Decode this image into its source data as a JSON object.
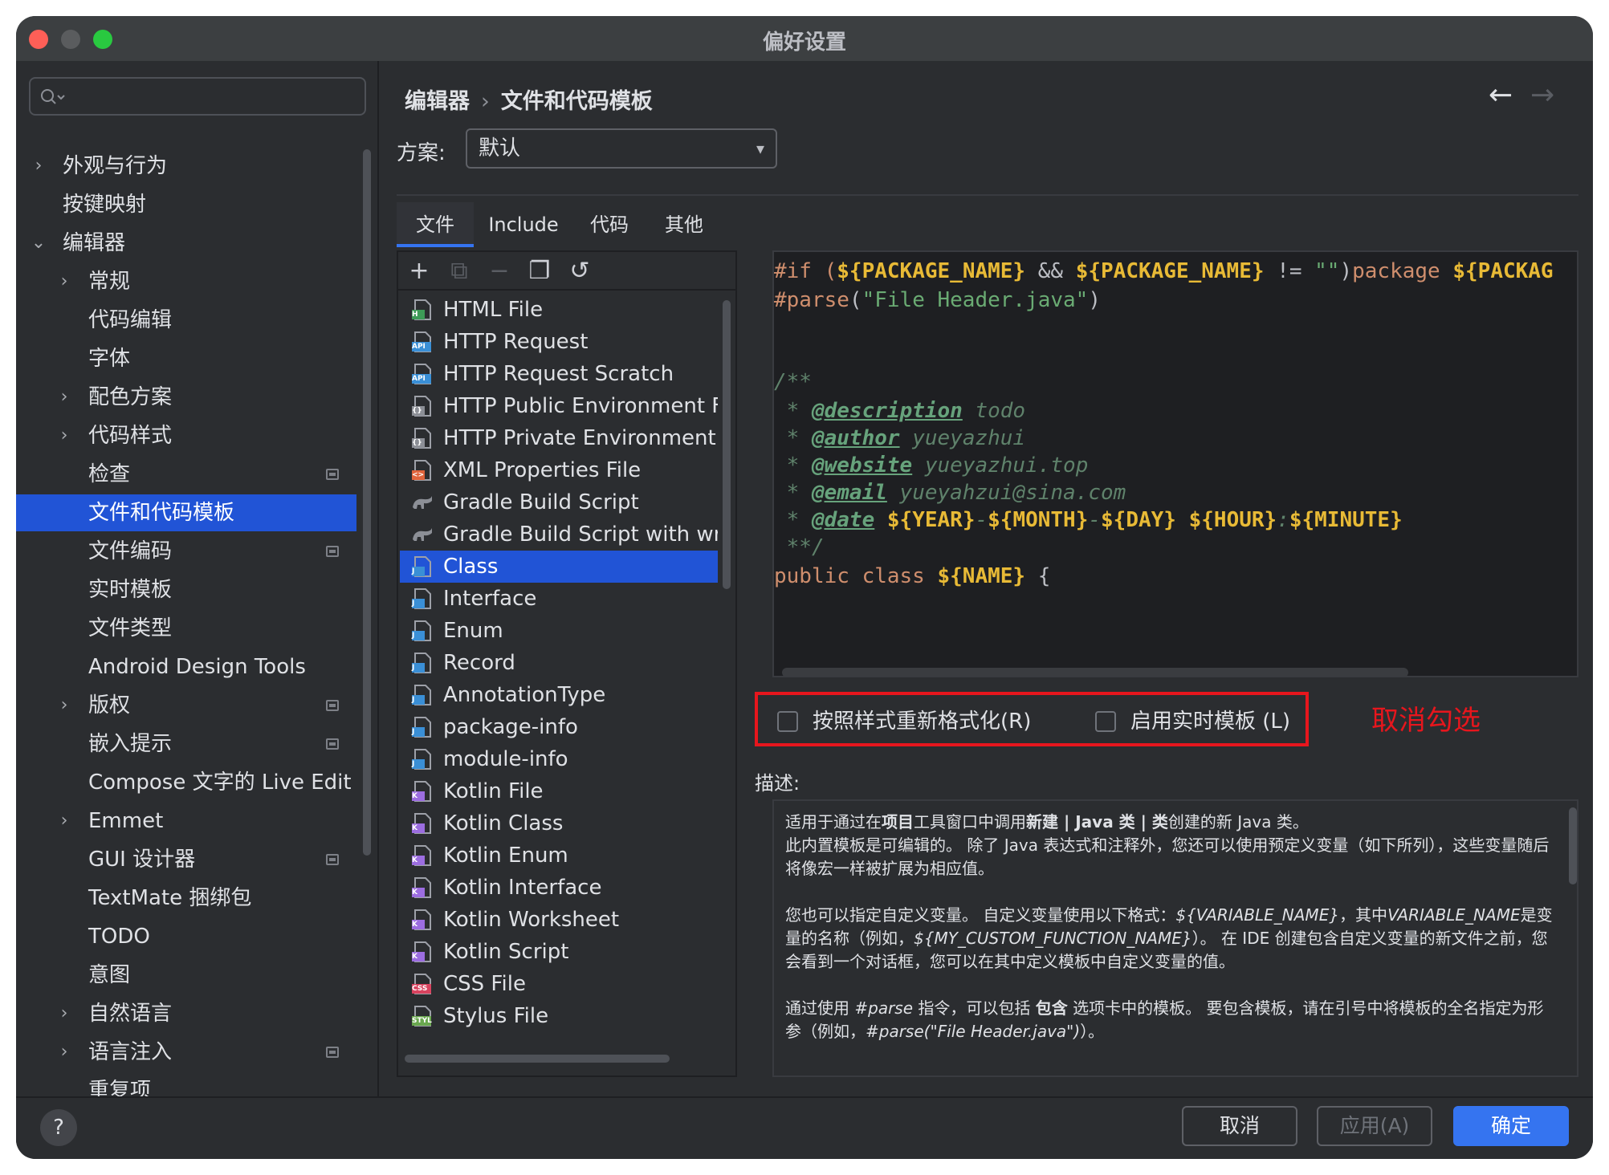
{
  "window": {
    "title": "偏好设置"
  },
  "search": {
    "placeholder": ""
  },
  "sidebar": {
    "items": [
      {
        "label": "外观与行为",
        "chevron": "›",
        "badge": false,
        "selected": false
      },
      {
        "label": "按键映射",
        "chevron": "",
        "badge": false,
        "selected": false
      },
      {
        "label": "编辑器",
        "chevron": "⌄",
        "badge": false,
        "selected": false
      },
      {
        "label": "常规",
        "chevron": "›",
        "badge": false,
        "selected": false
      },
      {
        "label": "代码编辑",
        "chevron": "",
        "badge": false,
        "selected": false
      },
      {
        "label": "字体",
        "chevron": "",
        "badge": false,
        "selected": false
      },
      {
        "label": "配色方案",
        "chevron": "›",
        "badge": false,
        "selected": false
      },
      {
        "label": "代码样式",
        "chevron": "›",
        "badge": false,
        "selected": false
      },
      {
        "label": "检查",
        "chevron": "",
        "badge": true,
        "selected": false
      },
      {
        "label": "文件和代码模板",
        "chevron": "",
        "badge": false,
        "selected": true
      },
      {
        "label": "文件编码",
        "chevron": "",
        "badge": true,
        "selected": false
      },
      {
        "label": "实时模板",
        "chevron": "",
        "badge": false,
        "selected": false
      },
      {
        "label": "文件类型",
        "chevron": "",
        "badge": false,
        "selected": false
      },
      {
        "label": "Android Design Tools",
        "chevron": "",
        "badge": false,
        "selected": false
      },
      {
        "label": "版权",
        "chevron": "›",
        "badge": true,
        "selected": false
      },
      {
        "label": "嵌入提示",
        "chevron": "",
        "badge": true,
        "selected": false
      },
      {
        "label": "Compose 文字的 Live Edit",
        "chevron": "",
        "badge": false,
        "selected": false
      },
      {
        "label": "Emmet",
        "chevron": "›",
        "badge": false,
        "selected": false
      },
      {
        "label": "GUI 设计器",
        "chevron": "",
        "badge": true,
        "selected": false
      },
      {
        "label": "TextMate 捆绑包",
        "chevron": "",
        "badge": false,
        "selected": false
      },
      {
        "label": "TODO",
        "chevron": "",
        "badge": false,
        "selected": false
      },
      {
        "label": "意图",
        "chevron": "",
        "badge": false,
        "selected": false
      },
      {
        "label": "自然语言",
        "chevron": "›",
        "badge": false,
        "selected": false
      },
      {
        "label": "语言注入",
        "chevron": "›",
        "badge": true,
        "selected": false
      },
      {
        "label": "重复项",
        "chevron": "",
        "badge": false,
        "selected": false
      }
    ]
  },
  "breadcrumb": {
    "parent": "编辑器",
    "separator": "›",
    "current": "文件和代码模板"
  },
  "nav": {
    "back": "←",
    "forward": "→"
  },
  "scheme": {
    "label": "方案:",
    "value": "默认",
    "arrow": "▾"
  },
  "tabs": [
    {
      "label": "文件",
      "active": true
    },
    {
      "label": "Include",
      "active": false
    },
    {
      "label": "代码",
      "active": false
    },
    {
      "label": "其他",
      "active": false
    }
  ],
  "toolbar": {
    "add": "+",
    "copy_add": "⧉",
    "remove": "−",
    "copy": "❐",
    "reset": "↺"
  },
  "templates": [
    {
      "label": "HTML File",
      "icon": "html",
      "color": "#3d9b57",
      "tag": "H",
      "selected": false
    },
    {
      "label": "HTTP Request",
      "icon": "api",
      "color": "#3a8fd6",
      "tag": "API",
      "selected": false
    },
    {
      "label": "HTTP Request Scratch",
      "icon": "api",
      "color": "#3a8fd6",
      "tag": "API",
      "selected": false
    },
    {
      "label": "HTTP Public Environment Fil",
      "icon": "env",
      "color": "#8c8f96",
      "tag": "{}",
      "selected": false
    },
    {
      "label": "HTTP Private Environment Fi",
      "icon": "env",
      "color": "#8c8f96",
      "tag": "{}",
      "selected": false
    },
    {
      "label": "XML Properties File",
      "icon": "xml",
      "color": "#e0643c",
      "tag": "<>",
      "selected": false
    },
    {
      "label": "Gradle Build Script",
      "icon": "gradle",
      "color": "#8c8f96",
      "tag": "",
      "selected": false
    },
    {
      "label": "Gradle Build Script with wrap",
      "icon": "gradle",
      "color": "#8c8f96",
      "tag": "",
      "selected": false
    },
    {
      "label": "Class",
      "icon": "java",
      "color": "#3a8fd6",
      "tag": "J",
      "selected": true
    },
    {
      "label": "Interface",
      "icon": "java",
      "color": "#3a8fd6",
      "tag": "J",
      "selected": false
    },
    {
      "label": "Enum",
      "icon": "java",
      "color": "#3a8fd6",
      "tag": "J",
      "selected": false
    },
    {
      "label": "Record",
      "icon": "java",
      "color": "#3a8fd6",
      "tag": "J",
      "selected": false
    },
    {
      "label": "AnnotationType",
      "icon": "java",
      "color": "#3a8fd6",
      "tag": "J",
      "selected": false
    },
    {
      "label": "package-info",
      "icon": "java",
      "color": "#3a8fd6",
      "tag": "J",
      "selected": false
    },
    {
      "label": "module-info",
      "icon": "java",
      "color": "#3a8fd6",
      "tag": "J",
      "selected": false
    },
    {
      "label": "Kotlin File",
      "icon": "kotlin",
      "color": "#9c6de0",
      "tag": "K",
      "selected": false
    },
    {
      "label": "Kotlin Class",
      "icon": "kotlin",
      "color": "#9c6de0",
      "tag": "K",
      "selected": false
    },
    {
      "label": "Kotlin Enum",
      "icon": "kotlin",
      "color": "#9c6de0",
      "tag": "K",
      "selected": false
    },
    {
      "label": "Kotlin Interface",
      "icon": "kotlin",
      "color": "#9c6de0",
      "tag": "K",
      "selected": false
    },
    {
      "label": "Kotlin Worksheet",
      "icon": "kotlin",
      "color": "#9c6de0",
      "tag": "K",
      "selected": false
    },
    {
      "label": "Kotlin Script",
      "icon": "kotlin",
      "color": "#9c6de0",
      "tag": "K",
      "selected": false
    },
    {
      "label": "CSS File",
      "icon": "css",
      "color": "#d8435f",
      "tag": "CSS",
      "selected": false
    },
    {
      "label": "Stylus File",
      "icon": "styl",
      "color": "#6aa84f",
      "tag": "STYL",
      "selected": false
    }
  ],
  "editor": {
    "lines": [
      [
        [
          "k",
          "#if ("
        ],
        [
          "d",
          "${PACKAGE_NAME}"
        ],
        [
          "w",
          " && "
        ],
        [
          "d",
          "${PACKAGE_NAME}"
        ],
        [
          "w",
          " != "
        ],
        [
          "s",
          "\"\""
        ],
        [
          "w",
          ")"
        ],
        [
          "k",
          "package "
        ],
        [
          "d",
          "${PACKAG"
        ]
      ],
      [
        [
          "k",
          "#parse"
        ],
        [
          "w",
          "("
        ],
        [
          "s",
          "\"File Header.java\""
        ],
        [
          "w",
          ")"
        ]
      ],
      [],
      [],
      [
        [
          "c",
          "/**"
        ]
      ],
      [
        [
          "c",
          " * "
        ],
        [
          "tag",
          "@description"
        ],
        [
          "c",
          " todo"
        ]
      ],
      [
        [
          "c",
          " * "
        ],
        [
          "tag",
          "@author"
        ],
        [
          "c",
          " yueyazhui"
        ]
      ],
      [
        [
          "c",
          " * "
        ],
        [
          "tag",
          "@website"
        ],
        [
          "c",
          " yueyazhui.top"
        ]
      ],
      [
        [
          "c",
          " * "
        ],
        [
          "tag",
          "@email"
        ],
        [
          "c",
          " yueyahzui@sina.com"
        ]
      ],
      [
        [
          "c",
          " * "
        ],
        [
          "tag",
          "@date"
        ],
        [
          "w",
          " "
        ],
        [
          "d",
          "${YEAR}"
        ],
        [
          "c",
          "-"
        ],
        [
          "d",
          "${MONTH}"
        ],
        [
          "c",
          "-"
        ],
        [
          "d",
          "${DAY}"
        ],
        [
          "w",
          " "
        ],
        [
          "d",
          "${HOUR}"
        ],
        [
          "c",
          ":"
        ],
        [
          "d",
          "${MINUTE}"
        ]
      ],
      [
        [
          "c",
          " **/"
        ]
      ],
      [
        [
          "k",
          "public class "
        ],
        [
          "d",
          "${NAME}"
        ],
        [
          "w",
          " {"
        ]
      ]
    ]
  },
  "options": {
    "reformat_label": "按照样式重新格式化(R)",
    "reformat_checked": false,
    "live_templates_label": "启用实时模板 (L)",
    "live_templates_checked": false
  },
  "annotation": {
    "text": "取消勾选",
    "color": "#e7161d"
  },
  "description": {
    "label": "描述:",
    "paragraphs": [
      "适用于通过在<b>项目</b>工具窗口中调用<b>新建 | Java 类 | 类</b>创建的新 Java 类。<br>此内置模板是可编辑的。 除了 Java 表达式和注释外，您还可以使用预定义变量（如下所列），这些变量随后将像宏一样被扩展为相应值。",
      "您也可以指定自定义变量。 自定义变量使用以下格式：<i>${VARIABLE_NAME}</i>，其中<i>VARIABLE_NAME</i>是变量的名称（例如，<i>${MY_CUSTOM_FUNCTION_NAME}</i>）。 在 IDE 创建包含自定义变量的新文件之前，您会看到一个对话框，您可以在其中定义模板中自定义变量的值。",
      "通过使用 <i>#parse</i> 指令，可以包括 <b>包含</b> 选项卡中的模板。 要包含模板，请在引号中将模板的全名指定为形参（例如，<i>#parse(\"File Header.java\")</i>）。"
    ]
  },
  "footer": {
    "help": "?",
    "cancel": "取消",
    "apply": "应用(A)",
    "ok": "确定"
  },
  "colors": {
    "accent": "#3574f0",
    "selection": "#2154d6",
    "background": "#2b2d30",
    "editor_bg": "#1e1f22"
  }
}
